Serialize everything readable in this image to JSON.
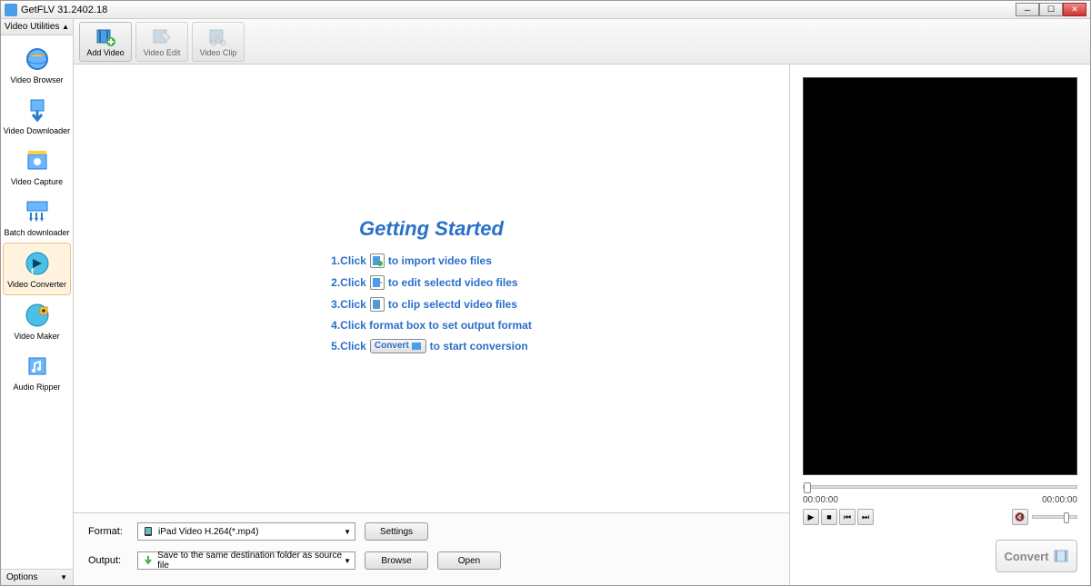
{
  "titlebar": {
    "title": "GetFLV 31.2402.18"
  },
  "sidebar": {
    "header": "Video Utilities",
    "items": [
      {
        "label": "Video Browser"
      },
      {
        "label": "Video Downloader"
      },
      {
        "label": "Video Capture"
      },
      {
        "label": "Batch downloader"
      },
      {
        "label": "Video Converter"
      },
      {
        "label": "Video Maker"
      },
      {
        "label": "Audio Ripper"
      }
    ],
    "footer": "Options"
  },
  "toolbar": {
    "add_video": "Add Video",
    "video_edit": "Video Edit",
    "video_clip": "Video Clip"
  },
  "instructions": {
    "title": "Getting Started",
    "line1a": "1.Click",
    "line1b": "to import video files",
    "line2a": "2.Click",
    "line2b": "to edit selectd video files",
    "line3a": "3.Click",
    "line3b": "to clip selectd video files",
    "line4": "4.Click format box to set output format",
    "line5a": "5.Click",
    "line5_badge": "Convert",
    "line5b": "to start conversion"
  },
  "bottom": {
    "format_label": "Format:",
    "format_value": "iPad Video H.264(*.mp4)",
    "output_label": "Output:",
    "output_value": "Save to the same destination folder as source file",
    "settings_btn": "Settings",
    "browse_btn": "Browse",
    "open_btn": "Open"
  },
  "preview": {
    "time_start": "00:00:00",
    "time_end": "00:00:00"
  },
  "convert": {
    "label": "Convert"
  }
}
